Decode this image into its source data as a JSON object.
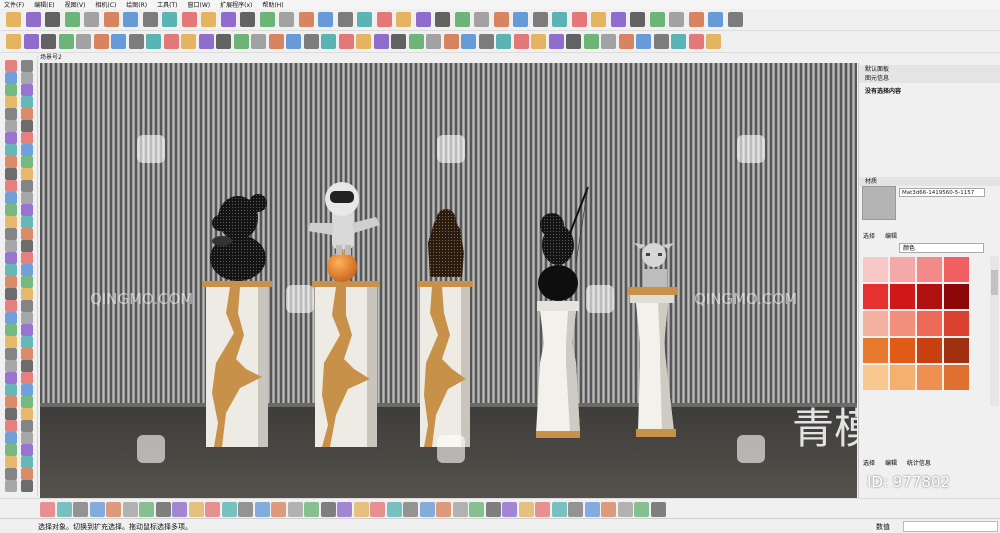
{
  "menubar": [
    "文件(F)",
    "编辑(E)",
    "视图(V)",
    "相机(C)",
    "绘图(R)",
    "工具(T)",
    "窗口(W)",
    "扩展程序(x)",
    "帮助(H)"
  ],
  "scene_tab": "场景号2",
  "tray": {
    "title": "默认面板",
    "entity_info": {
      "header": "图元信息",
      "text": "没有选择内容"
    },
    "materials": {
      "header": "材质",
      "name": "Mat3d66-1419560-5-1157",
      "tabs": [
        "选择",
        "编辑"
      ],
      "collection": "颜色",
      "swatches": [
        "#f8c8c8",
        "#f4a8a8",
        "#f28a8a",
        "#f06060",
        "#e73030",
        "#d01818",
        "#b01010",
        "#8c0808",
        "#f4b0a0",
        "#f28e7c",
        "#ec6a58",
        "#d84030",
        "#e87a30",
        "#e05a18",
        "#c84010",
        "#a03010",
        "#f8c890",
        "#f5b070",
        "#f09050",
        "#e07030"
      ],
      "bottom_tabs": [
        "选择",
        "编辑",
        "统计信息"
      ]
    }
  },
  "status": {
    "text": "选择对象。切换到扩充选择。拖动鼠标选择多项。",
    "measure_label": "数值",
    "measure_value": ""
  },
  "viewport": {
    "watermark": "QINGMO.COM",
    "logo": "青模网",
    "id_text": "ID: 977802"
  },
  "colors": {
    "wall": "#8c8c8c",
    "floor": "#4a4844",
    "gold": "#c8914a",
    "orange": "#e8862c"
  }
}
